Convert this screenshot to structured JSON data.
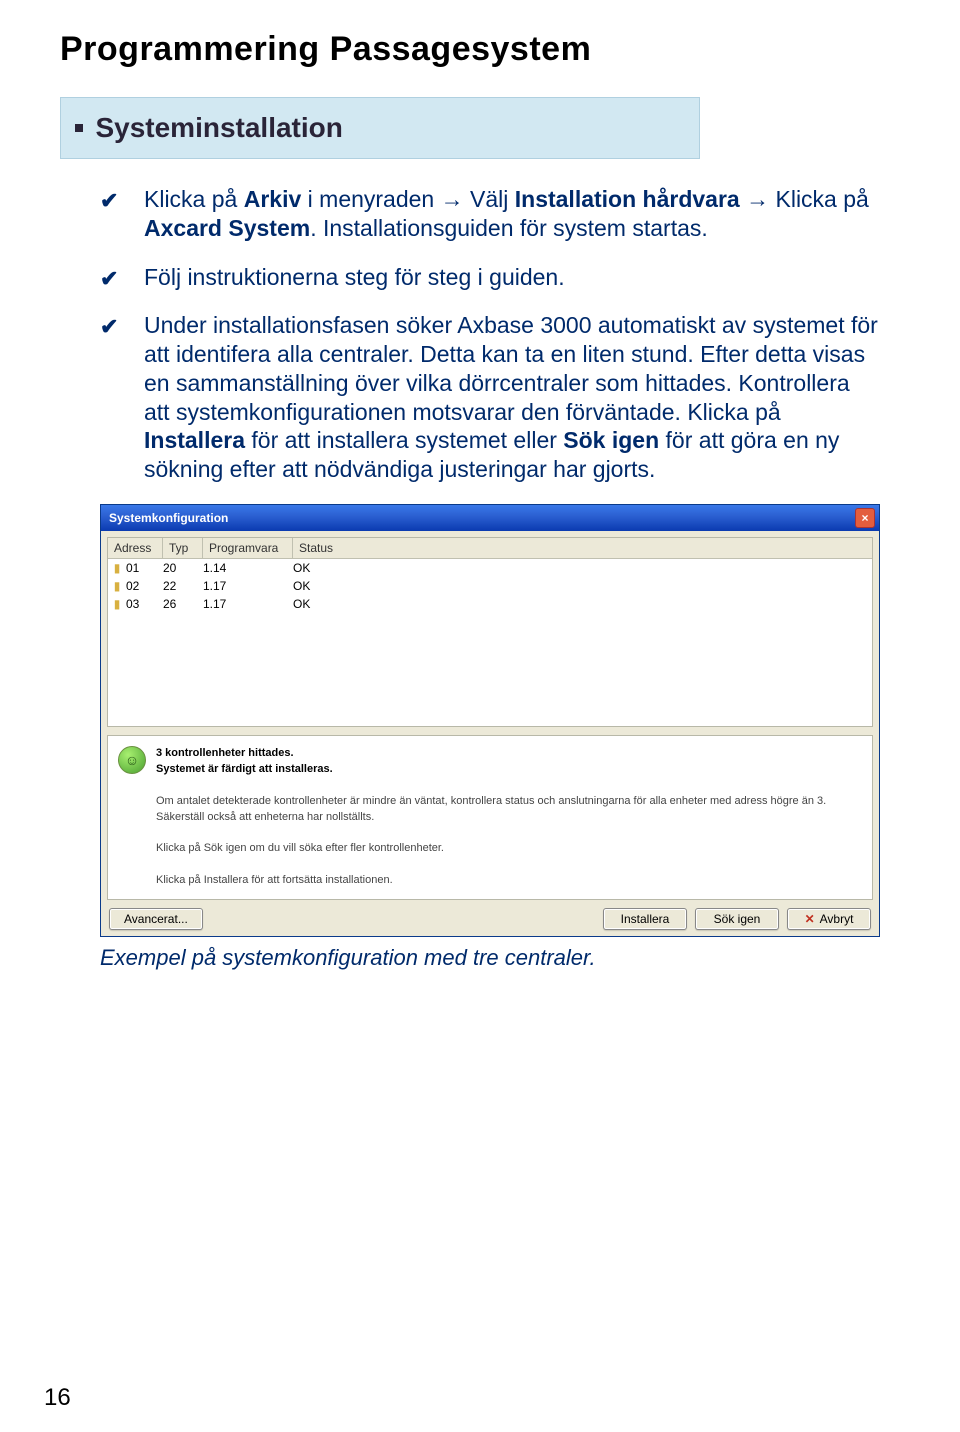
{
  "title": "Programmering Passagesystem",
  "section": {
    "heading": "Systeminstallation"
  },
  "bullets": {
    "b1a": "Klicka på ",
    "b1b": "Arkiv",
    "b1c": " i menyraden → Välj ",
    "b1d": "Installation hårdvara",
    "b1e": " → Klicka på ",
    "b1f": "Axcard System",
    "b1g": ". Installationsguiden för system startas.",
    "b2": "Följ instruktionerna steg för steg i guiden.",
    "b3a": "Under installationsfasen söker Axbase 3000 automatiskt av systemet för att identifera alla centraler. Detta kan ta en liten stund. Efter detta visas en sammanställning över vilka dörrcentraler som hittades. Kontrollera att systemkonfigura­tionen motsvarar den förväntade. Klicka på ",
    "b3b": "Installera",
    "b3c": " för att installera systemet eller ",
    "b3d": "Sök igen",
    "b3e": " för att göra en ny sökning efter att nödvändiga justeringar har gjorts."
  },
  "dialog": {
    "title": "Systemkonfiguration",
    "columns": {
      "adress": "Adress",
      "typ": "Typ",
      "programvara": "Programvara",
      "status": "Status"
    },
    "rows": [
      {
        "adress": "01",
        "typ": "20",
        "prog": "1.14",
        "status": "OK"
      },
      {
        "adress": "02",
        "typ": "22",
        "prog": "1.17",
        "status": "OK"
      },
      {
        "adress": "03",
        "typ": "26",
        "prog": "1.17",
        "status": "OK"
      }
    ],
    "info": {
      "heading": "3 kontrollenheter hittades.",
      "sub": "Systemet är färdigt att installeras.",
      "p1": "Om antalet detekterade kontrollenheter är mindre än väntat, kontrollera status och anslutningarna för alla enheter med adress högre än 3. Säkerställ också att enheterna har nollställts.",
      "p2": "Klicka på Sök igen om du vill söka efter fler kontrollenheter.",
      "p3": "Klicka på Installera för att fortsätta installationen."
    },
    "buttons": {
      "avancerat": "Avancerat...",
      "installera": "Installera",
      "sokigen": "Sök igen",
      "avbryt": "Avbryt"
    }
  },
  "caption": "Exempel på systemkonfiguration med tre centraler.",
  "pagenum": "16"
}
